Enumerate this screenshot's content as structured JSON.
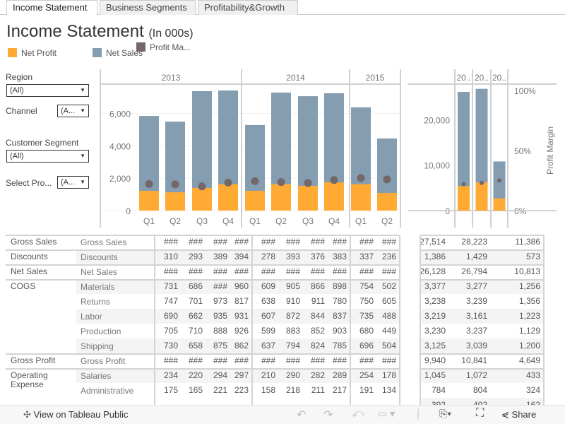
{
  "tabs": [
    {
      "label": "Income Statement",
      "active": true
    },
    {
      "label": "Business Segments"
    },
    {
      "label": "Profitability&Growth"
    }
  ],
  "title": {
    "main": "Income Statement",
    "sub": "(In 000s)"
  },
  "legend": [
    {
      "label": "Net Profit",
      "color": "#FFAA33"
    },
    {
      "label": "Net Sales",
      "color": "#849DB1"
    },
    {
      "label": "Profit Ma...",
      "color": "#74676A"
    }
  ],
  "filters": {
    "region": {
      "label": "Region",
      "value": "(All)"
    },
    "channel": {
      "label": "Channel",
      "value": "(A..."
    },
    "segment": {
      "label": "Customer Segment",
      "value": "(All)"
    },
    "product": {
      "label": "Select Pro...",
      "value": "(A..."
    }
  },
  "chart_data": [
    {
      "type": "bar",
      "stacked": "overlay",
      "years": [
        "2013",
        "2014",
        "2015"
      ],
      "categories": [
        [
          "2013",
          "Q1"
        ],
        [
          "2013",
          "Q2"
        ],
        [
          "2013",
          "Q3"
        ],
        [
          "2013",
          "Q4"
        ],
        [
          "2014",
          "Q1"
        ],
        [
          "2014",
          "Q2"
        ],
        [
          "2014",
          "Q3"
        ],
        [
          "2014",
          "Q4"
        ],
        [
          "2015",
          "Q1"
        ],
        [
          "2015",
          "Q2"
        ]
      ],
      "quarter_labels": [
        "Q1",
        "Q2",
        "Q3",
        "Q4",
        "Q1",
        "Q2",
        "Q3",
        "Q4",
        "Q1",
        "Q2"
      ],
      "series": [
        {
          "name": "Net Sales",
          "color": "#849DB1",
          "values": [
            5840,
            5490,
            7370,
            7410,
            5280,
            7280,
            7060,
            7240,
            6370,
            4450
          ]
        },
        {
          "name": "Net Profit",
          "color": "#FFAA33",
          "values": [
            1220,
            1130,
            1400,
            1630,
            1220,
            1630,
            1530,
            1740,
            1630,
            1090
          ]
        },
        {
          "name": "Profit Margin",
          "color": "#74676A",
          "type": "scatter",
          "values": [
            0.209,
            0.206,
            0.19,
            0.22,
            0.231,
            0.224,
            0.217,
            0.24,
            0.256,
            0.245
          ]
        }
      ],
      "ylim": [
        0,
        7850
      ],
      "yticks": [
        0,
        2000,
        4000,
        6000
      ],
      "ytick_labels": [
        "0",
        "2,000",
        "4,000",
        "6,000"
      ],
      "margin_ylim": [
        0,
        1
      ]
    },
    {
      "type": "bar",
      "stacked": "overlay",
      "categories": [
        "20..",
        "20..",
        "20.."
      ],
      "series": [
        {
          "name": "Net Sales",
          "color": "#849DB1",
          "values": [
            26128,
            26794,
            10813
          ]
        },
        {
          "name": "Net Profit",
          "color": "#FFAA33",
          "values": [
            5380,
            6200,
            2700
          ]
        },
        {
          "name": "Profit Margin",
          "color": "#74676A",
          "type": "scatter",
          "values": [
            0.22,
            0.23,
            0.25
          ]
        }
      ],
      "ylim": [
        0,
        26900
      ],
      "yticks": [
        0,
        10000,
        20000
      ],
      "ytick_labels": [
        "0",
        "10,000",
        "20,000"
      ],
      "y2label": "Profit Margin",
      "y2ticks": [
        0,
        0.5,
        1
      ],
      "y2tick_labels": [
        "0%",
        "50%",
        "100%"
      ]
    }
  ],
  "table": {
    "rows": [
      {
        "cat": "Gross Sales",
        "sub": "Gross Sales",
        "vals": [
          "###",
          "###",
          "###",
          "###",
          "###",
          "###",
          "###",
          "###",
          "###",
          "###"
        ],
        "tot": [
          "27,514",
          "28,223",
          "11,386"
        ],
        "sep": true
      },
      {
        "cat": "Discounts",
        "sub": "Discounts",
        "vals": [
          "310",
          "293",
          "389",
          "394",
          "278",
          "393",
          "376",
          "383",
          "337",
          "236"
        ],
        "tot": [
          "1,386",
          "1,429",
          "573"
        ],
        "sep": true
      },
      {
        "cat": "Net Sales",
        "sub": "Net Sales",
        "vals": [
          "###",
          "###",
          "###",
          "###",
          "###",
          "###",
          "###",
          "###",
          "###",
          "###"
        ],
        "tot": [
          "26,128",
          "26,794",
          "10,813"
        ],
        "sep": true
      },
      {
        "cat": "COGS",
        "sub": "Materials",
        "vals": [
          "731",
          "686",
          "###",
          "960",
          "609",
          "905",
          "866",
          "898",
          "754",
          "502"
        ],
        "tot": [
          "3,377",
          "3,277",
          "1,256"
        ],
        "sep": true
      },
      {
        "cat": "",
        "sub": "Returns",
        "vals": [
          "747",
          "701",
          "973",
          "817",
          "638",
          "910",
          "911",
          "780",
          "750",
          "605"
        ],
        "tot": [
          "3,238",
          "3,239",
          "1,356"
        ]
      },
      {
        "cat": "",
        "sub": "Labor",
        "vals": [
          "690",
          "662",
          "935",
          "931",
          "607",
          "872",
          "844",
          "837",
          "735",
          "488"
        ],
        "tot": [
          "3,219",
          "3,161",
          "1,223"
        ]
      },
      {
        "cat": "",
        "sub": "Production",
        "vals": [
          "705",
          "710",
          "888",
          "926",
          "599",
          "883",
          "852",
          "903",
          "680",
          "449"
        ],
        "tot": [
          "3,230",
          "3,237",
          "1,129"
        ]
      },
      {
        "cat": "",
        "sub": "Shipping",
        "vals": [
          "730",
          "658",
          "875",
          "862",
          "637",
          "794",
          "824",
          "785",
          "696",
          "504"
        ],
        "tot": [
          "3,125",
          "3,039",
          "1,200"
        ]
      },
      {
        "cat": "Gross Profit",
        "sub": "Gross Profit",
        "vals": [
          "###",
          "###",
          "###",
          "###",
          "###",
          "###",
          "###",
          "###",
          "###",
          "###"
        ],
        "tot": [
          "9,940",
          "10,841",
          "4,649"
        ],
        "sep": true
      },
      {
        "cat": "Operating",
        "sub": "Salaries",
        "vals": [
          "234",
          "220",
          "294",
          "297",
          "210",
          "290",
          "282",
          "289",
          "254",
          "178"
        ],
        "tot": [
          "1,045",
          "1,072",
          "433"
        ],
        "sep": true
      },
      {
        "cat": "Expense",
        "sub": "Administrative",
        "vals": [
          "175",
          "165",
          "221",
          "223",
          "158",
          "218",
          "211",
          "217",
          "191",
          "134"
        ],
        "tot": [
          "784",
          "804",
          "324"
        ]
      },
      {
        "cat": "",
        "sub": "",
        "vals": [],
        "tot": [
          "392",
          "402",
          "162"
        ]
      }
    ]
  },
  "footer": {
    "view_label": "View on Tableau Public",
    "share_label": "Share"
  }
}
